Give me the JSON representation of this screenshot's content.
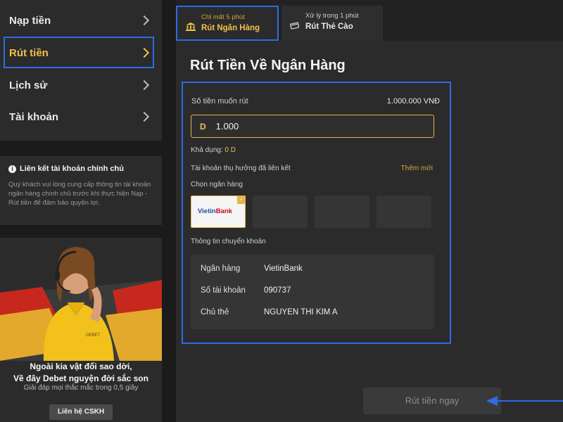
{
  "sidebar": {
    "items": [
      {
        "label": "Nạp tiền"
      },
      {
        "label": "Rút tiền"
      },
      {
        "label": "Lịch sử"
      },
      {
        "label": "Tài khoản"
      }
    ],
    "active_index": 1
  },
  "notice": {
    "title": "Liên kết tài khoản chính chủ",
    "body": "Quý khách vui lòng cung cấp thông tin tài khoản ngân hàng chính chủ trước khi thực hiện Nạp - Rút tiền để đảm bảo quyền lợi."
  },
  "promo": {
    "headline_line1": "Ngoài kia vật đổi sao dời,",
    "headline_line2": "Về đây Debet nguyện đời sắc son",
    "subtext": "Giải đáp mọi thắc mắc trong 0,5 giây",
    "button": "Liên hệ CSKH",
    "shirt_text": "DEBET"
  },
  "tabs": [
    {
      "sub": "Chỉ mất 5 phút",
      "label": "Rút Ngân Hàng"
    },
    {
      "sub": "Xử lý trong 1 phút",
      "label": "Rút Thẻ Cào"
    }
  ],
  "withdraw": {
    "title": "Rút Tiền Về Ngân Hàng",
    "amount_label": "Số tiền muốn rút",
    "amount_display": "1.000.000 VNĐ",
    "currency_prefix": "D",
    "amount_value": "1.000",
    "available_label": "Khả dụng:",
    "available_value": "0 D",
    "linked_label": "Tài khoản thụ hưởng đã liên kết",
    "add_new": "Thêm mới",
    "choose_bank_label": "Chọn ngân hàng",
    "bank_logo_text_a": "Vietin",
    "bank_logo_text_b": "Bank",
    "transfer_info_label": "Thông tin chuyển khoản",
    "rows": [
      {
        "label": "Ngân hàng",
        "value": "VietinBank"
      },
      {
        "label": "Số tài khoản",
        "value": "090737"
      },
      {
        "label": "Chủ thẻ",
        "value": "NGUYEN THI KIM A"
      }
    ],
    "submit": "Rút tiền ngay"
  },
  "colors": {
    "accent": "#f0c14b",
    "highlight_box": "#2e6be6",
    "panel": "#2b2b2b",
    "background": "#1b1b1b"
  }
}
